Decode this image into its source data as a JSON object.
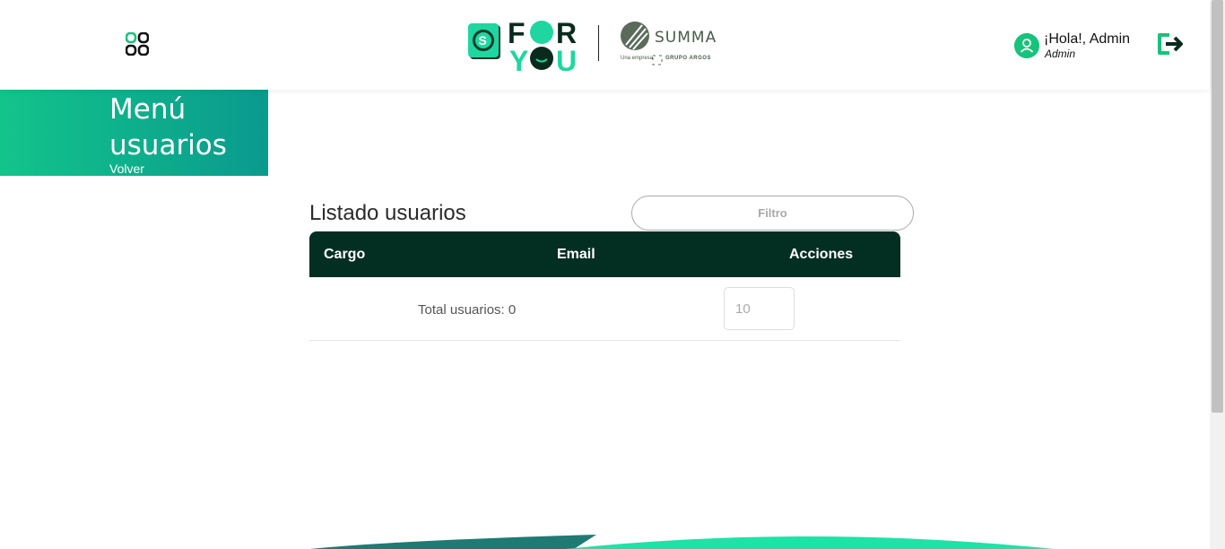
{
  "header": {
    "brand_name": "FOR YOU",
    "partner": {
      "name": "SUMMA",
      "sub_left": "Una empresa",
      "sub_right": "GRUPO ARGOS"
    },
    "greeting": "¡Hola!, Admin",
    "role": "Admin"
  },
  "menu": {
    "title": "Menú usuarios",
    "back_link": "Volver"
  },
  "list": {
    "title": "Listado usuarios",
    "filter_placeholder": "Filtro",
    "columns": [
      "Cargo",
      "Email",
      "Acciones"
    ],
    "rows": [],
    "total_label": "Total usuarios: 0",
    "page_size": "10"
  },
  "colors": {
    "brand_green": "#18c27a",
    "table_header": "#032e22",
    "banner_start": "#12c48a",
    "banner_end": "#0a9a8e"
  },
  "icons": {
    "apps": "apps-grid-icon",
    "user": "user-avatar-icon",
    "logout": "logout-icon"
  }
}
